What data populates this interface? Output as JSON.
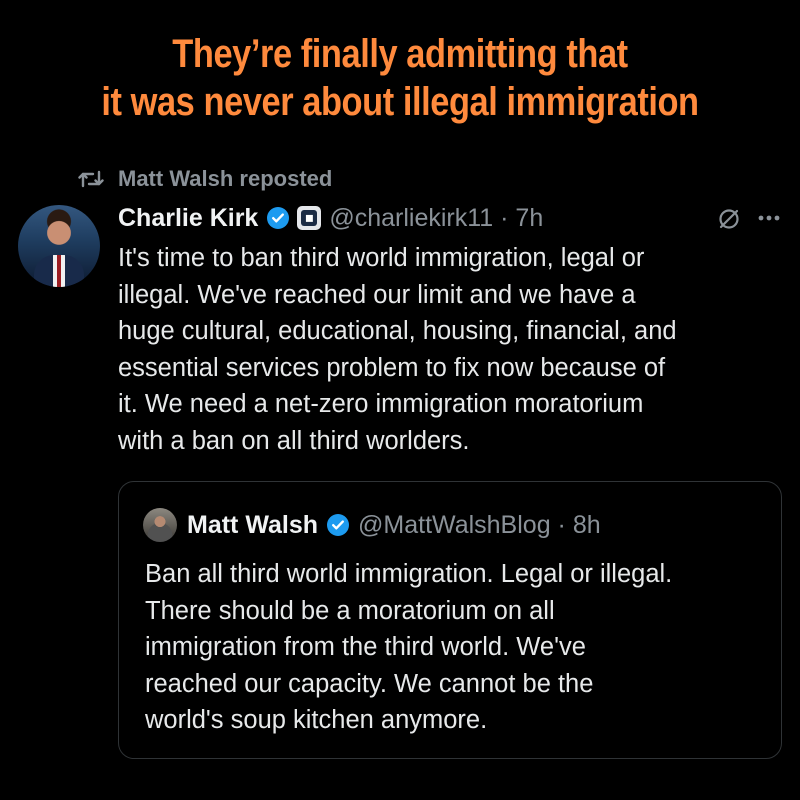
{
  "headline": {
    "lines": [
      "They’re finally admitting that",
      "it was never about illegal immigration"
    ],
    "color": "#ff8a3d"
  },
  "repost": {
    "icon": "repost-icon",
    "label": "Matt Walsh reposted"
  },
  "tweet": {
    "avatar_icon": "profile-photo",
    "author_name": "Charlie Kirk",
    "verified_icon": "verified-badge-icon",
    "affiliate_icon": "affiliate-badge-icon",
    "handle_time": "@charliekirk11 · 7h",
    "grok_icon": "grok-icon",
    "more_icon": "more-options-icon",
    "text_lines": [
      "It's time to ban third world immigration, legal or",
      "illegal. We've reached our limit and we have a",
      "huge cultural, educational, housing, financial, and",
      "essential services problem to fix now because of",
      "it. We need a net-zero immigration moratorium",
      "with a ban on all third worlders."
    ]
  },
  "quote": {
    "avatar_icon": "profile-photo",
    "author_name": "Matt Walsh",
    "verified_icon": "verified-badge-icon",
    "handle_time": "@MattWalshBlog · 8h",
    "text_lines": [
      "Ban all third world immigration. Legal or illegal.",
      "There should be a moratorium on all",
      "immigration from the third world. We've",
      "reached our capacity. We cannot be the",
      "world's soup kitchen anymore."
    ]
  },
  "colors": {
    "background": "#000000",
    "text_primary": "#e7e9ea",
    "text_secondary": "#8b9299",
    "verified_blue": "#1d9bf0",
    "border": "#2f3336"
  }
}
